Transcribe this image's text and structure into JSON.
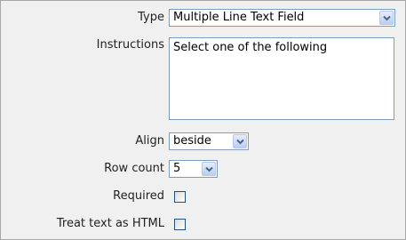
{
  "form": {
    "type": {
      "label": "Type",
      "value": "Multiple Line Text Field"
    },
    "instructions": {
      "label": "Instructions",
      "value": "Select one of the following"
    },
    "align": {
      "label": "Align",
      "value": "beside"
    },
    "row_count": {
      "label": "Row count",
      "value": "5"
    },
    "required": {
      "label": "Required",
      "checked": false
    },
    "treat_as_html": {
      "label": "Treat text as HTML",
      "checked": false
    }
  },
  "colors": {
    "panel_bg": "#f0f0f0",
    "field_border": "#7f9db9",
    "checkbox_border": "#1c5180",
    "arrow_color": "#4d6185"
  },
  "icons": {
    "dropdown": "chevron-down-icon"
  }
}
